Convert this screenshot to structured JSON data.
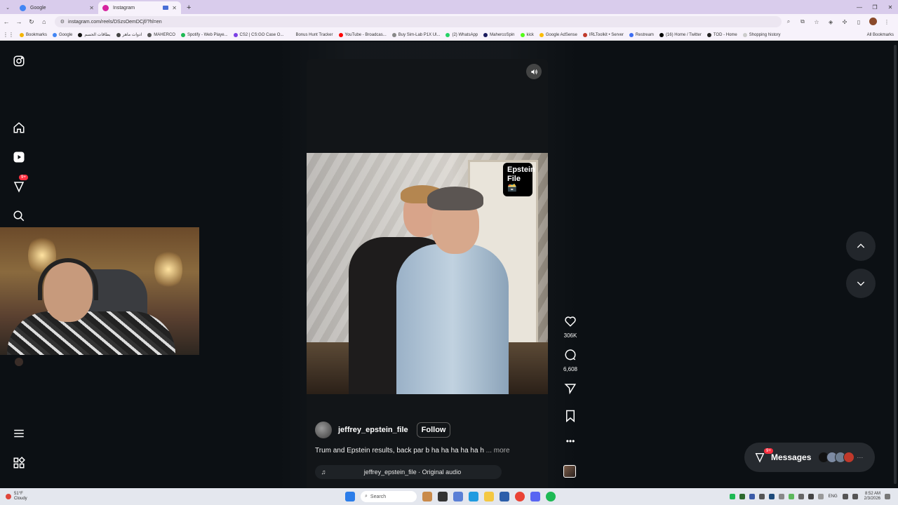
{
  "browser": {
    "tabs": [
      {
        "title": "Google",
        "favicon_color": "#4285f4"
      },
      {
        "title": "Instagram",
        "favicon_color": "#d6249f"
      }
    ],
    "new_tab_label": "+",
    "url": "instagram.com/reels/DSzsOemDCjf/?hl=en",
    "bookmarks": [
      {
        "label": "Bookmarks",
        "color": "#f4b400"
      },
      {
        "label": "Google",
        "color": "#4285f4"
      },
      {
        "label": "بطاقات الحسم",
        "color": "#111111"
      },
      {
        "label": "ادوات ماهر",
        "color": "#444444"
      },
      {
        "label": "MAHERCO",
        "color": "#555555"
      },
      {
        "label": "Spotify - Web Playe...",
        "color": "#1db954"
      },
      {
        "label": "CS2 | CS:GO Case O...",
        "color": "#7b3fe4"
      },
      {
        "label": "Bonus Hunt Tracker",
        "color": "#f7f2fb"
      },
      {
        "label": "YouTube - Broadcas...",
        "color": "#ff0000"
      },
      {
        "label": "Buy Sim-Lab P1X Ul...",
        "color": "#888888"
      },
      {
        "label": "(2) WhatsApp",
        "color": "#25d366"
      },
      {
        "label": "MahercoSpin",
        "color": "#1a1a5e"
      },
      {
        "label": "kick",
        "color": "#53fc18"
      },
      {
        "label": "Google AdSense",
        "color": "#fbbc04"
      },
      {
        "label": "IRLToolkit • Server",
        "color": "#c0392b"
      },
      {
        "label": "Restream",
        "color": "#3d6df2"
      },
      {
        "label": "(16) Home / Twitter",
        "color": "#000000"
      },
      {
        "label": "TOD - Home",
        "color": "#222222"
      },
      {
        "label": "Shopping history",
        "color": "#cccccc"
      }
    ],
    "all_bookmarks_label": "All Bookmarks"
  },
  "instagram": {
    "notifications_badge": "9+",
    "reel": {
      "sticker_text": "Epstein File 🗃️",
      "author": "jeffrey_epstein_file",
      "follow_label": "Follow",
      "caption": "Trum and Epstein results, back par b ha ha ha ha ha h",
      "more_label": "... more",
      "audio": "jeffrey_epstein_file · Original audio",
      "likes": "306K",
      "comments": "6,608"
    },
    "messages": {
      "label": "Messages",
      "badge": "9+",
      "more": "···"
    }
  },
  "taskbar": {
    "weather_temp": "51°F",
    "weather_desc": "Cloudy",
    "search_placeholder": "Search",
    "language": "ENG",
    "time": "8:52 AM",
    "date": "2/3/2026"
  }
}
